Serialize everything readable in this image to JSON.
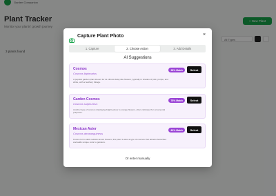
{
  "background": {
    "logo_text": "Garden Companion",
    "title": "Plant Tracker",
    "subtitle": "Monitor your plants' growth journey",
    "new_plant_label": "+ New Plant",
    "select_value": "All Types",
    "filter_label": "3 plants found"
  },
  "modal": {
    "title": "Capture Plant Photo",
    "close_glyph": "×",
    "steps": [
      {
        "label": "1. Capture",
        "active": false
      },
      {
        "label": "2. Choose Action",
        "active": true
      },
      {
        "label": "3. Add Details",
        "active": false
      }
    ],
    "section_title": "AI Suggestions",
    "suggestions": [
      {
        "name": "Cosmos",
        "scientific_name": "Cosmos bipinnatus",
        "description": "A popular garden plant known for its vibrant daisy-like flowers, typically in shades of pink, purple, and white, with a feathery foliage.",
        "match": "98% Match",
        "select_label": "Select"
      },
      {
        "name": "Garden Cosmos",
        "scientific_name": "Cosmos sulphureus",
        "description": "Another type of cosmos displaying bright yellow to orange flowers, often cultivated for ornamental purposes.",
        "match": "78% Match",
        "select_label": "Select"
      },
      {
        "name": "Mexican Aster",
        "scientific_name": "Cosmos atrosanguineus",
        "description": "Known for its dark reddish-brown flowers, this plant is also a type of cosmos that attracts butterflies and adds unique color to gardens.",
        "match": "60% Match",
        "select_label": "Select"
      }
    ],
    "manual_label": "Or enter manually"
  },
  "colors": {
    "accent": "#9b45d6",
    "card_bg": "#f7f1fc",
    "brand_green": "#16a34a"
  }
}
